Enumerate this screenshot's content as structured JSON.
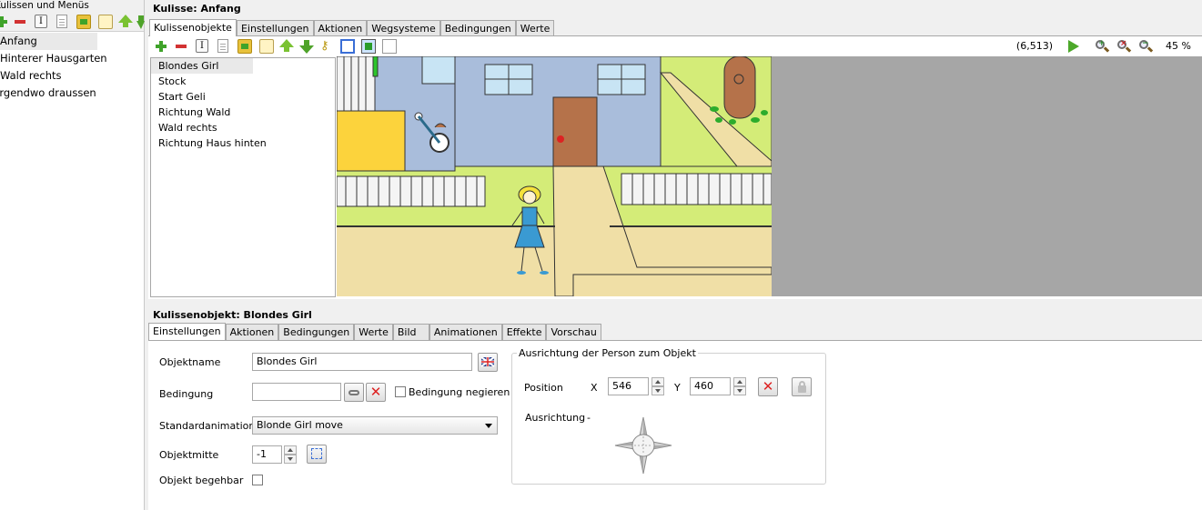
{
  "left_pane": {
    "title": "Kulissen und Menüs",
    "scenes": [
      "Anfang",
      "Hinterer Hausgarten",
      "Wald rechts",
      "Irgendwo draussen"
    ]
  },
  "scene": {
    "title": "Kulisse: Anfang",
    "tabs": [
      "Kulissenobjekte",
      "Einstellungen",
      "Aktionen",
      "Wegsysteme",
      "Bedingungen",
      "Werte"
    ],
    "objects": [
      "Blondes Girl",
      "Stock",
      "Start Geli",
      "Richtung Wald",
      "Wald rechts",
      "Richtung Haus hinten"
    ],
    "coordinate": "(6,513)",
    "zoom": "45 %"
  },
  "object": {
    "title": "Kulissenobjekt: Blondes Girl",
    "tabs": [
      "Einstellungen",
      "Aktionen",
      "Bedingungen",
      "Werte",
      "Bild",
      "Animationen",
      "Effekte",
      "Vorschau"
    ],
    "objektname_label": "Objektname",
    "objektname_value": "Blondes Girl",
    "bedingung_label": "Bedingung",
    "bedingung_value": "",
    "negieren_label": "Bedingung negieren",
    "standardanimation_label": "Standardanimation",
    "standardanimation_value": "Blonde Girl move",
    "objektmitte_label": "Objektmitte",
    "objektmitte_value": "-1",
    "begehbar_label": "Objekt begehbar",
    "orientation": {
      "legend": "Ausrichtung der Person zum Objekt",
      "position_label": "Position",
      "x_label": "X",
      "x_value": "546",
      "y_label": "Y",
      "y_value": "460",
      "ausrichtung_label": "Ausrichtung",
      "ausrichtung_value": "-"
    }
  },
  "colors": {
    "grass": "#d4ec78",
    "house": "#a9bddb",
    "door": "#b5724a",
    "path": "#f0dfa6",
    "gray_area": "#a6a6a6"
  }
}
